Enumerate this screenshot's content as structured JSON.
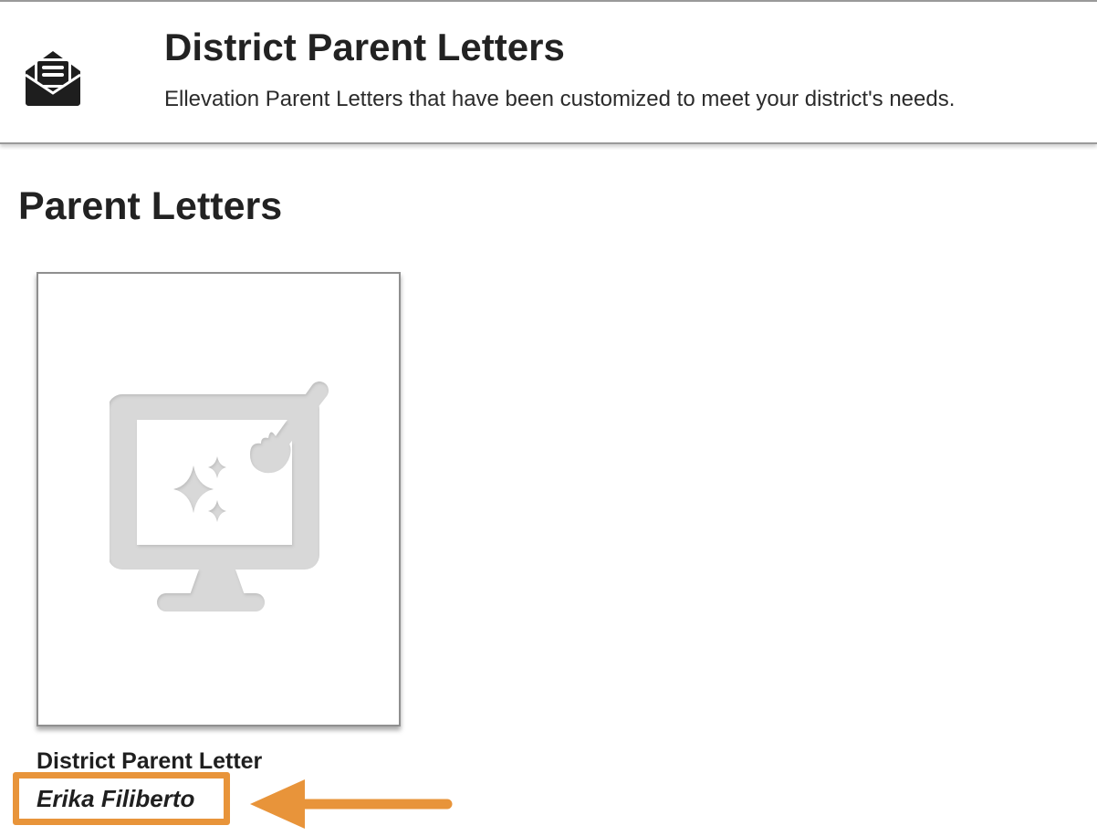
{
  "header": {
    "title": "District Parent Letters",
    "subtitle": "Ellevation Parent Letters that have been customized to meet your district's needs.",
    "icon": "open-envelope-letter-icon"
  },
  "main": {
    "section_title": "Parent Letters",
    "cards": [
      {
        "title": "District Parent Letter",
        "author": "Erika Filiberto",
        "thumbnail_icon": "computer-paintbrush-sparkles-icon"
      }
    ]
  },
  "annotation": {
    "highlight_color": "#e8943a",
    "pointer": "left-arrow-icon"
  }
}
